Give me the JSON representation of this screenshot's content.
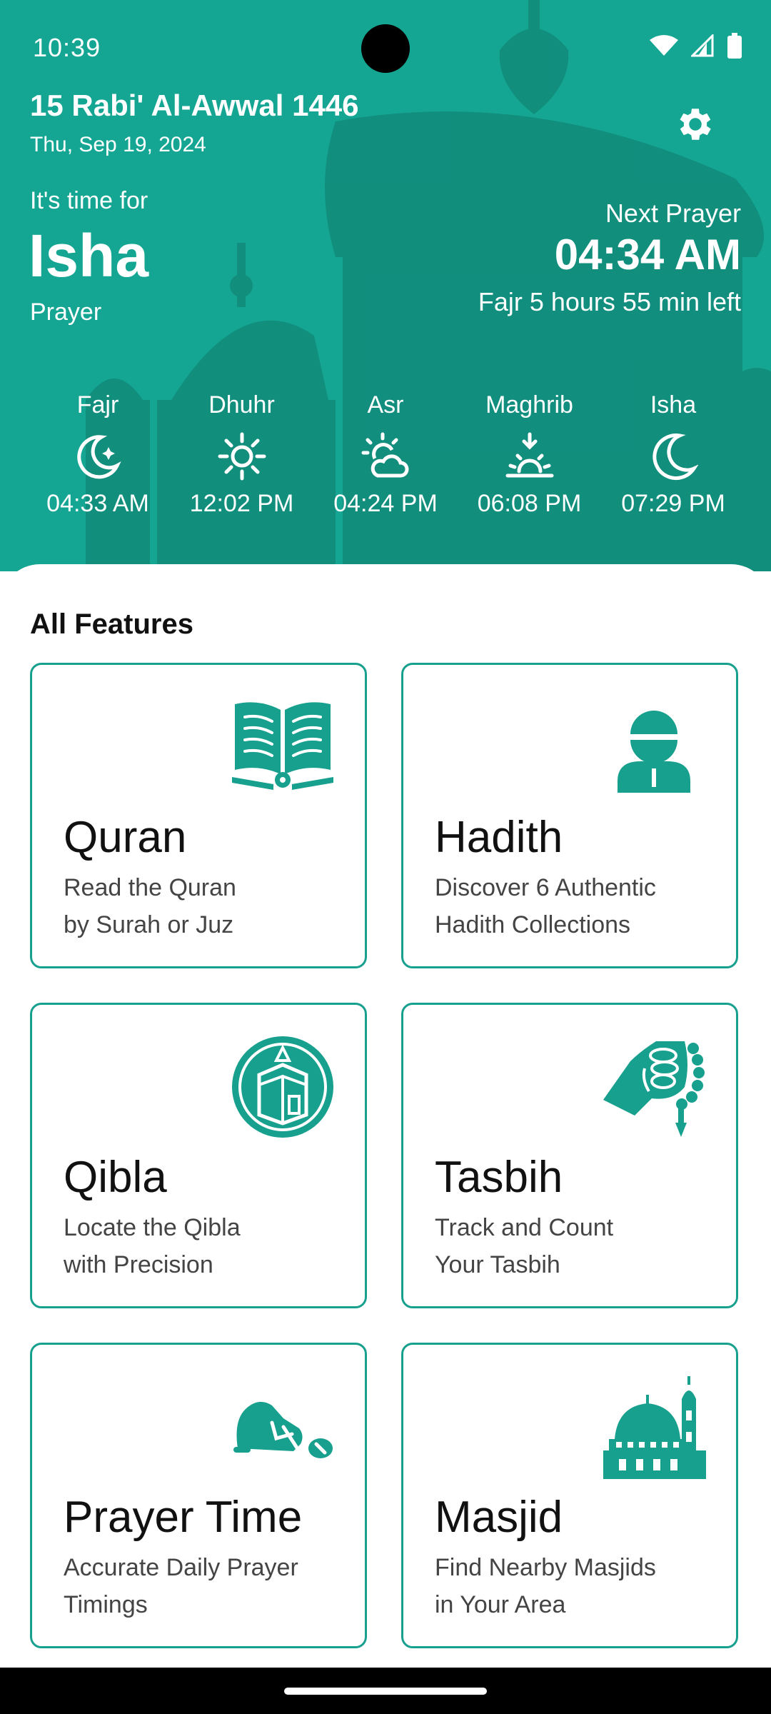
{
  "status_bar": {
    "time": "10:39"
  },
  "header": {
    "hijri_date": "15 Rabi' Al-Awwal 1446",
    "gregorian_date": "Thu, Sep 19, 2024",
    "its_time_for": "It's time for",
    "current_prayer_name": "Isha",
    "current_prayer_label": "Prayer",
    "next_prayer_label": "Next Prayer",
    "next_prayer_time": "04:34 AM",
    "next_prayer_countdown": "Fajr 5 hours 55 min left"
  },
  "prayers": [
    {
      "name": "Fajr",
      "time": "04:33 AM",
      "icon": "moon-star-icon"
    },
    {
      "name": "Dhuhr",
      "time": "12:02 PM",
      "icon": "sun-icon"
    },
    {
      "name": "Asr",
      "time": "04:24 PM",
      "icon": "sun-cloud-icon"
    },
    {
      "name": "Maghrib",
      "time": "06:08 PM",
      "icon": "sunset-icon"
    },
    {
      "name": "Isha",
      "time": "07:29 PM",
      "icon": "crescent-moon-icon"
    }
  ],
  "features": {
    "title": "All Features",
    "items": [
      {
        "title": "Quran",
        "line1": "Read the Quran",
        "line2": "by Surah or Juz",
        "icon": "quran-book-icon"
      },
      {
        "title": "Hadith",
        "line1": "Discover 6 Authentic",
        "line2": "Hadith Collections",
        "icon": "scholar-icon"
      },
      {
        "title": "Qibla",
        "line1": "Locate the Qibla",
        "line2": "with Precision",
        "icon": "kaaba-compass-icon"
      },
      {
        "title": "Tasbih",
        "line1": "Track and Count",
        "line2": "Your Tasbih",
        "icon": "tasbih-hand-icon"
      },
      {
        "title": "Prayer Time",
        "line1": "Accurate Daily Prayer",
        "line2": "Timings",
        "icon": "prostration-icon"
      },
      {
        "title": "Masjid",
        "line1": "Find Nearby Masjids",
        "line2": "in Your Area",
        "icon": "mosque-icon"
      }
    ]
  },
  "colors": {
    "primary": "#14a693",
    "primary_dark": "#118a7a",
    "card_border": "#17a08d"
  }
}
